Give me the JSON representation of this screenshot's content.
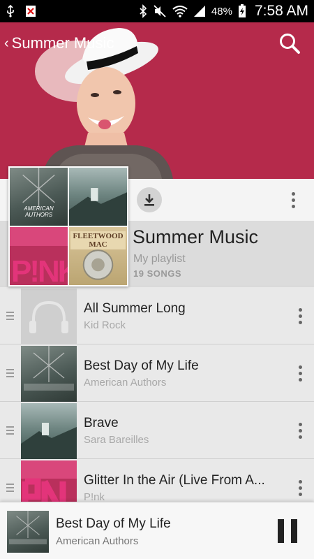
{
  "status_bar": {
    "battery": "48%",
    "time": "7:58 AM"
  },
  "header": {
    "title": "Summer Music"
  },
  "playlist": {
    "title": "Summer Music",
    "subtitle": "My playlist",
    "count": "19 SONGS",
    "collage": {
      "tile_aa_text": "AMERICAN AUTHORS",
      "tile_pk_letters": "P!NK",
      "tile_fm_text": "FLEETWOOD MAC"
    }
  },
  "songs": [
    {
      "title": "All Summer Long",
      "artist": "Kid Rock"
    },
    {
      "title": "Best Day of My Life",
      "artist": "American Authors"
    },
    {
      "title": "Brave",
      "artist": "Sara Bareilles"
    },
    {
      "title": "Glitter In the Air (Live From A...",
      "artist": "P!nk"
    }
  ],
  "now_playing": {
    "title": "Best Day of My Life",
    "artist": "American Authors"
  },
  "colors": {
    "hero_red": "#b0284a",
    "pink_album": "#e3347a"
  }
}
